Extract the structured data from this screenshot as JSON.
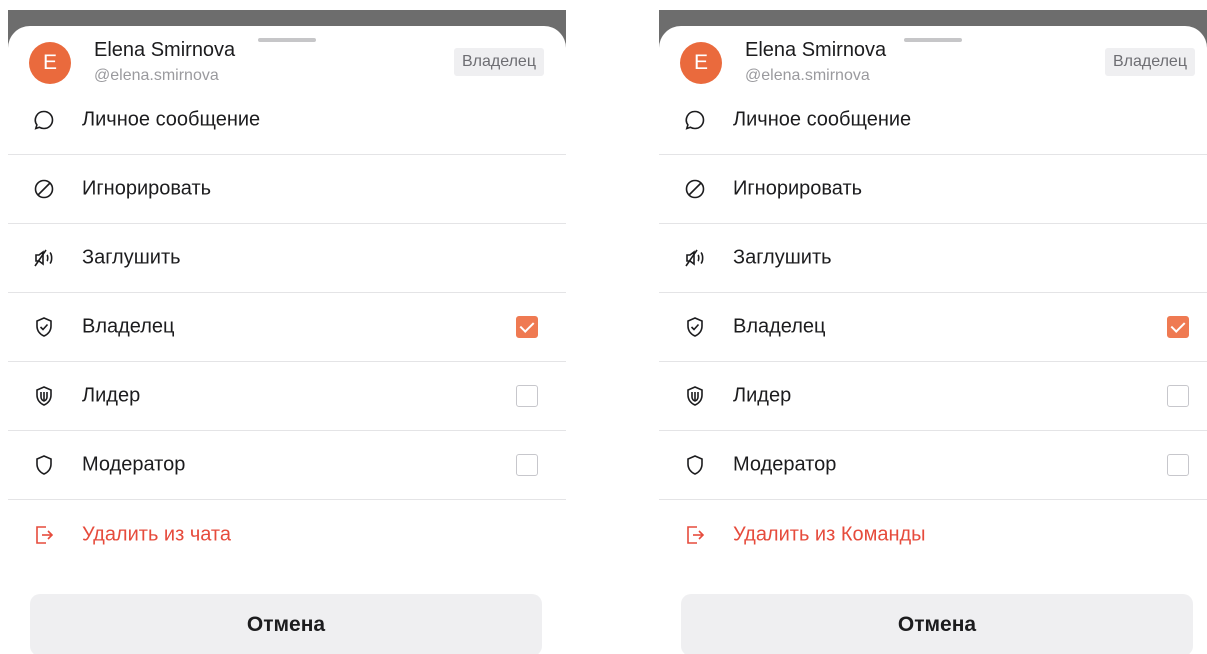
{
  "panels": [
    {
      "user": {
        "initial": "E",
        "name": "Elena Smirnova",
        "handle": "@elena.smirnova",
        "role_badge": "Владелец",
        "avatar_color": "#ea6a3d"
      },
      "menu": {
        "message": "Личное сообщение",
        "ignore": "Игнорировать",
        "mute": "Заглушить",
        "owner": {
          "label": "Владелец",
          "checked": true
        },
        "leader": {
          "label": "Лидер",
          "checked": false
        },
        "moderator": {
          "label": "Модератор",
          "checked": false
        },
        "remove": "Удалить из чата"
      },
      "cancel_label": "Отмена"
    },
    {
      "user": {
        "initial": "E",
        "name": "Elena Smirnova",
        "handle": "@elena.smirnova",
        "role_badge": "Владелец",
        "avatar_color": "#ea6a3d"
      },
      "menu": {
        "message": "Личное сообщение",
        "ignore": "Игнорировать",
        "mute": "Заглушить",
        "owner": {
          "label": "Владелец",
          "checked": true
        },
        "leader": {
          "label": "Лидер",
          "checked": false
        },
        "moderator": {
          "label": "Модератор",
          "checked": false
        },
        "remove": "Удалить из Команды"
      },
      "cancel_label": "Отмена"
    }
  ],
  "colors": {
    "accent": "#ef7a52",
    "danger": "#e64b3c",
    "backdrop": "#6d6d6d"
  },
  "icons": [
    "message-icon",
    "block-icon",
    "mute-icon",
    "shield-check-icon",
    "shield-leader-icon",
    "shield-icon",
    "exit-icon"
  ]
}
